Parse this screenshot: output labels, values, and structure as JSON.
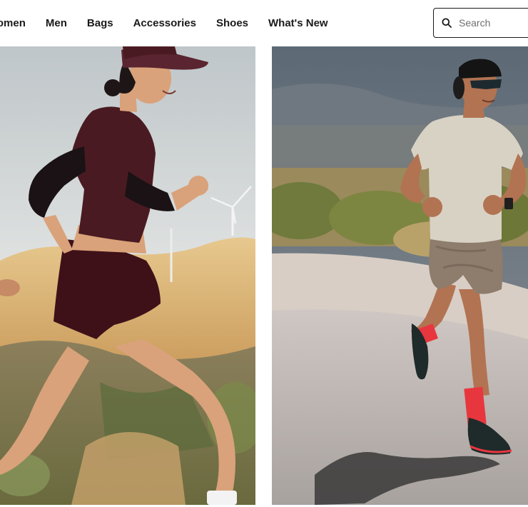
{
  "nav": {
    "items": [
      {
        "label": "Women"
      },
      {
        "label": "Men"
      },
      {
        "label": "Bags"
      },
      {
        "label": "Accessories"
      },
      {
        "label": "Shoes"
      },
      {
        "label": "What's New"
      }
    ]
  },
  "search": {
    "placeholder": "Search",
    "icon": "search-icon"
  },
  "hero": {
    "left_image": "woman-trail-running-photo",
    "right_image": "man-road-running-photo"
  },
  "colors": {
    "text": "#1a1a1a",
    "background": "#ffffff",
    "sock_red": "#e8363f",
    "maroon_outfit": "#4a1a22"
  }
}
